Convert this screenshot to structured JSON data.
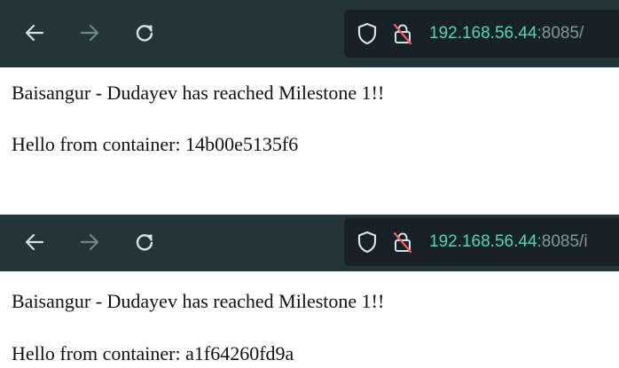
{
  "colors": {
    "toolbar_bg": "#24353a",
    "urlbar_bg": "#172126",
    "url_host": "#4ed8b8",
    "url_path": "#7e9a96",
    "icon_light": "#cfe6e3",
    "icon_dim": "#6f8784",
    "tracking_slash": "#ff5a5f"
  },
  "icons": {
    "back": "arrow-left",
    "forward": "arrow-right",
    "reload": "refresh",
    "shield": "shield-outline",
    "lock": "lock-crossed"
  },
  "screenshots": [
    {
      "url_host": "192.168.56.44",
      "url_rest": ":8085/",
      "lines": [
        "Baisangur - Dudayev has reached Milestone 1!!",
        "Hello from container: 14b00e5135f6"
      ]
    },
    {
      "url_host": "192.168.56.44",
      "url_rest": ":8085/i",
      "lines": [
        "Baisangur - Dudayev has reached Milestone 1!!",
        "Hello from container: a1f64260fd9a"
      ]
    }
  ]
}
